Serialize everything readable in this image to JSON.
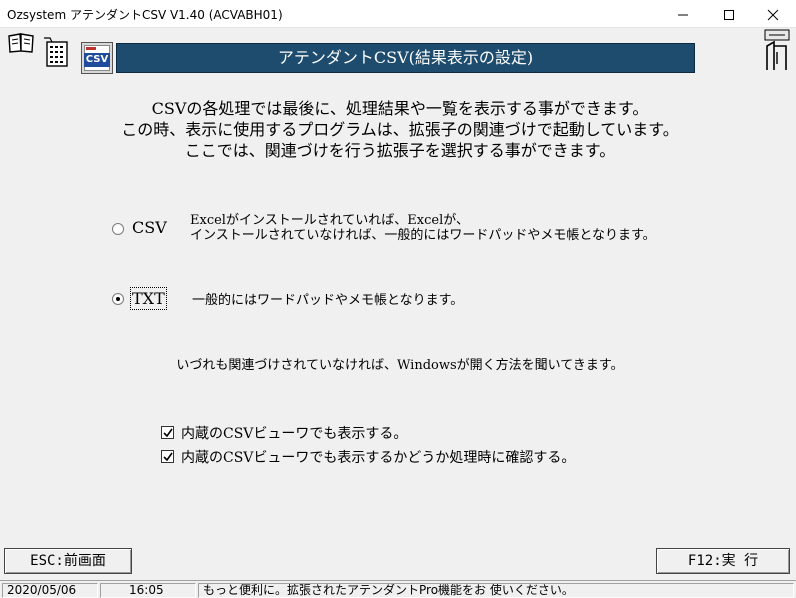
{
  "window": {
    "title": "Ozsystem アテンダントCSV V1.40 (ACVABH01)"
  },
  "banner": {
    "title": "アテンダントCSV(結果表示の設定)"
  },
  "toolbar": {
    "csv_icon_label": "CSV"
  },
  "intro": {
    "lines": [
      "CSVの各処理では最後に、処理結果や一覧を表示する事ができます。",
      "この時、表示に使用するプログラムは、拡張子の関連づけで起動しています。",
      "ここでは、関連づけを行う拡張子を選択する事ができます。"
    ]
  },
  "options": [
    {
      "label": "CSV",
      "checked": false,
      "desc": [
        "Excelがインストールされていれば、Excelが、",
        "インストールされていなければ、一般的にはワードパッドやメモ帳となります。"
      ]
    },
    {
      "label": "TXT",
      "checked": true,
      "desc": [
        "一般的にはワードパッドやメモ帳となります。"
      ]
    }
  ],
  "note": "いづれも関連づけされていなければ、Windowsが開く方法を聞いてきます。",
  "checkboxes": [
    {
      "label": "内蔵のCSVビューワでも表示する。",
      "checked": true
    },
    {
      "label": "内蔵のCSVビューワでも表示するかどうか処理時に確認する。",
      "checked": true
    }
  ],
  "buttons": {
    "back": "ESC:前画面",
    "run": "F12:実 行"
  },
  "status": {
    "date": "2020/05/06",
    "time": "16:05",
    "message": "もっと便利に。拡張されたアテンダントPro機能をお 使いください。"
  },
  "colors": {
    "banner_bg": "#1e4c6e",
    "window_bg": "#f0f0f0"
  }
}
